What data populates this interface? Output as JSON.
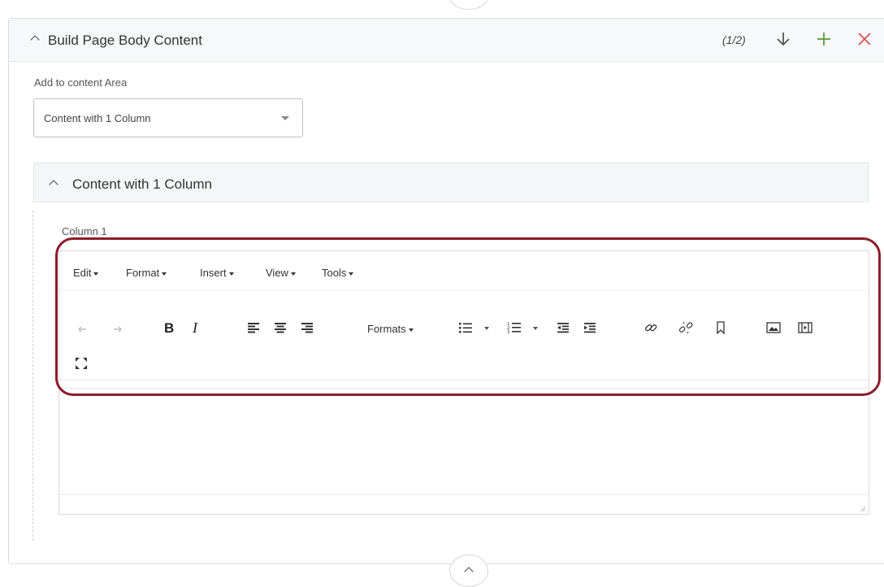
{
  "panel": {
    "title": "Build Page Body Content",
    "counter": "(1/2)",
    "add_label": "Add to content Area",
    "select_value": "Content with 1 Column"
  },
  "subpanel": {
    "title": "Content with 1 Column"
  },
  "editor": {
    "column_label": "Column 1",
    "menu": [
      "Edit",
      "Format",
      "Insert",
      "View",
      "Tools"
    ],
    "formats_label": "Formats"
  },
  "colors": {
    "highlight": "#8b1c2b",
    "add_icon": "#5a9a3a",
    "close_icon": "#d9534f"
  },
  "icons": [
    "chevron-up-icon",
    "arrow-down-icon",
    "plus-icon",
    "close-icon",
    "undo-icon",
    "redo-icon",
    "bold-icon",
    "italic-icon",
    "align-left-icon",
    "align-center-icon",
    "align-right-icon",
    "bullet-list-icon",
    "numbered-list-icon",
    "outdent-icon",
    "indent-icon",
    "link-icon",
    "unlink-icon",
    "bookmark-icon",
    "image-icon",
    "media-icon",
    "fullscreen-icon",
    "resize-grip-icon"
  ]
}
